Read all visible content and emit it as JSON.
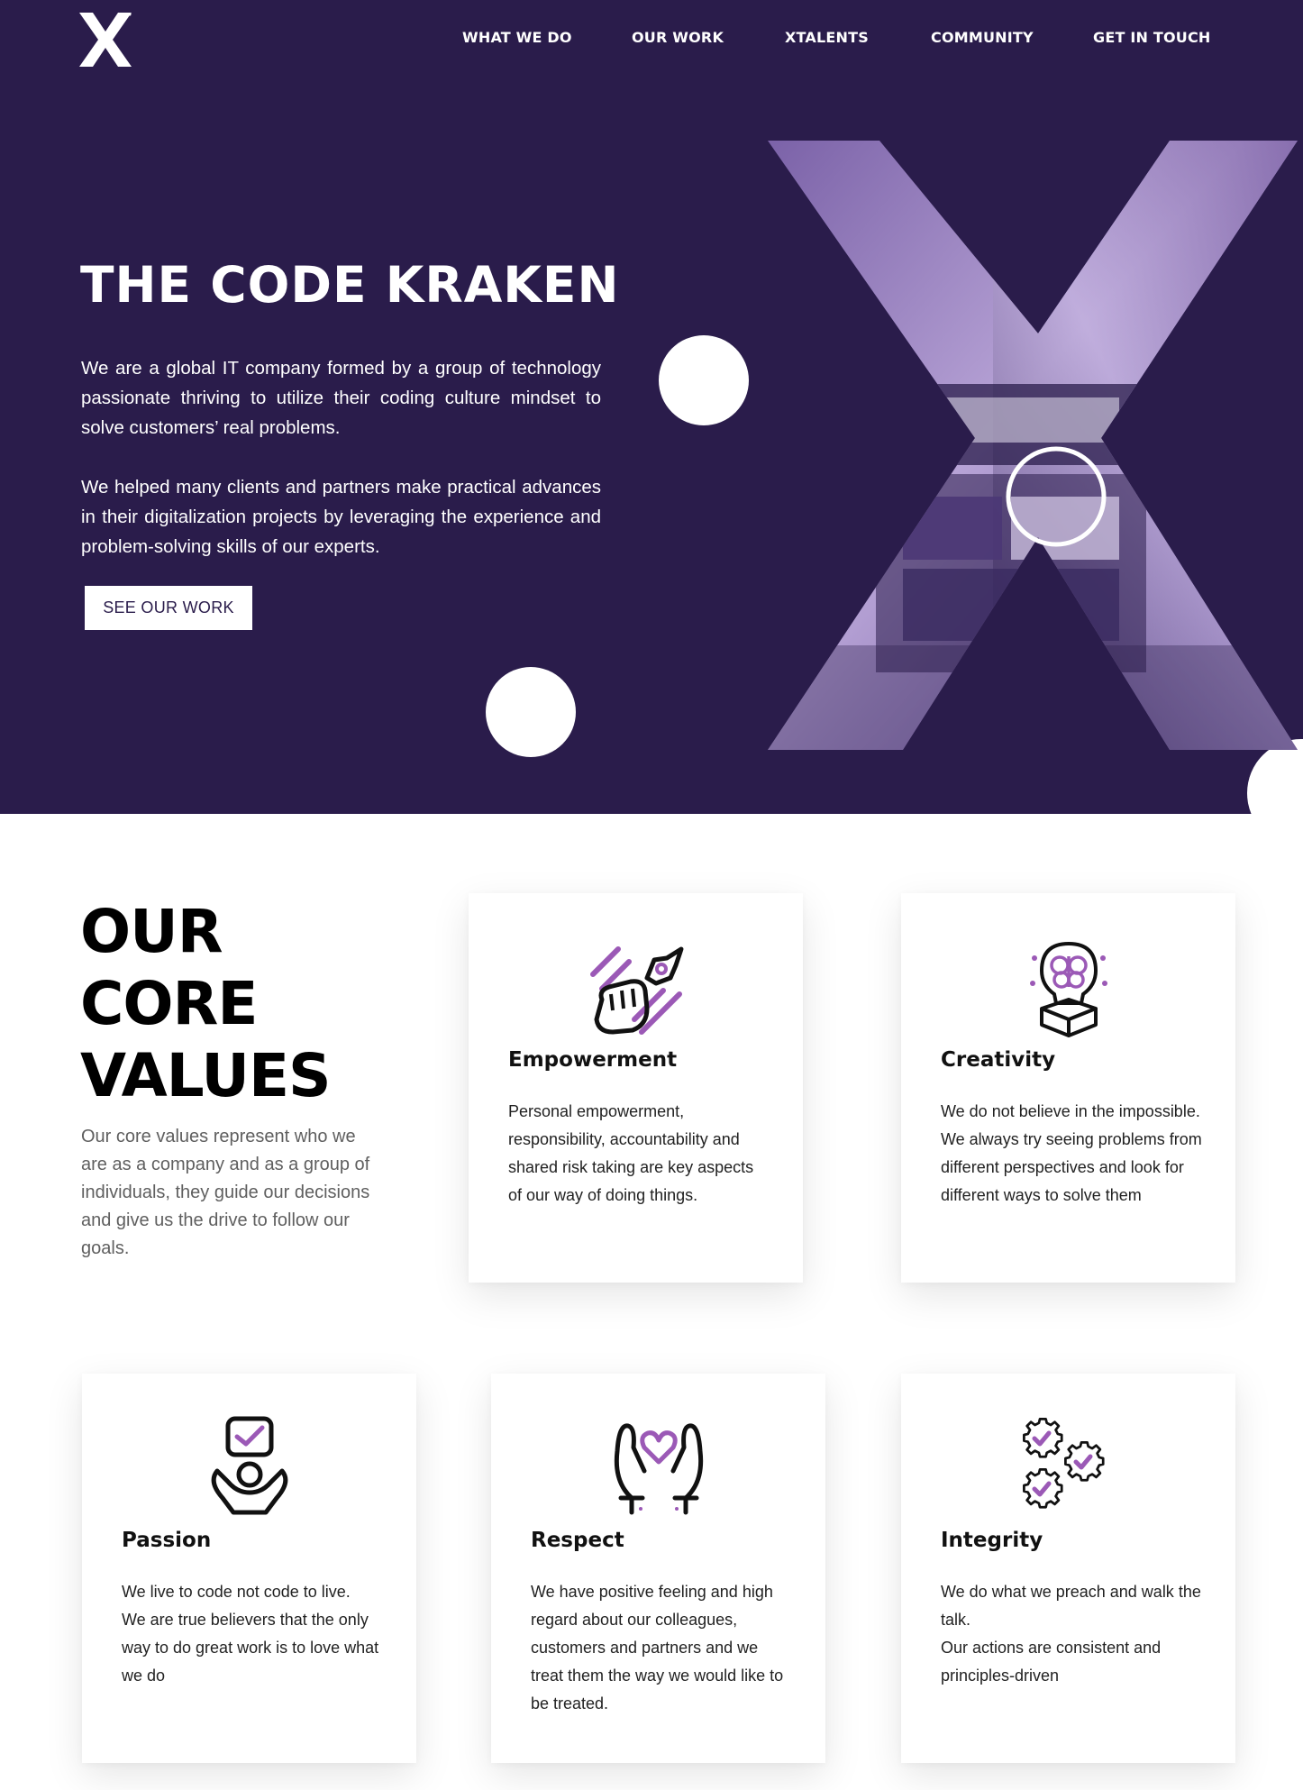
{
  "nav": {
    "items": [
      "WHAT WE DO",
      "OUR WORK",
      "XTALENTS",
      "COMMUNITY",
      "GET IN TOUCH"
    ]
  },
  "hero": {
    "title": "THE CODE KRAKEN",
    "paragraph1": "We are a global IT company formed by a group of technology passionate thriving to utilize their coding culture mindset to solve customers’ real problems.",
    "paragraph2": "We helped many clients and partners make practical advances in their digitalization projects by leveraging the experience and problem-solving skills of our experts.",
    "button": "SEE OUR WORK"
  },
  "values": {
    "title_lines": [
      "OUR",
      "CORE",
      "VALUES"
    ],
    "description": "Our core values represent who we are as a company and as a group of individuals, they guide our decisions and give us the drive to follow our goals.",
    "cards": [
      {
        "title": "Empowerment",
        "icon": "fist-rocket-icon",
        "lines": [
          "Personal empowerment, responsibility, accountability and shared risk taking are key aspects of our way of doing things."
        ]
      },
      {
        "title": "Creativity",
        "icon": "brain-lightbulb-icon",
        "lines": [
          "We do not believe in the impossible. We always try seeing problems from different perspectives and look for different ways to solve them"
        ]
      },
      {
        "title": "Passion",
        "icon": "heart-check-icon",
        "lines": [
          "We live to code not code to live.",
          "We are true believers that the only way to do great work is to love what we do"
        ]
      },
      {
        "title": "Respect",
        "icon": "hands-heart-icon",
        "lines": [
          "We have positive feeling and high regard about our colleagues, customers and partners and we treat them the way we would like to be treated."
        ]
      },
      {
        "title": "Integrity",
        "icon": "gears-check-icon",
        "lines": [
          "We do what we preach and walk the talk.",
          "Our actions are consistent and principles-driven"
        ]
      }
    ]
  },
  "colors": {
    "hero_bg": "#2a1c4b",
    "accent": "#9b59b6",
    "white": "#ffffff"
  }
}
